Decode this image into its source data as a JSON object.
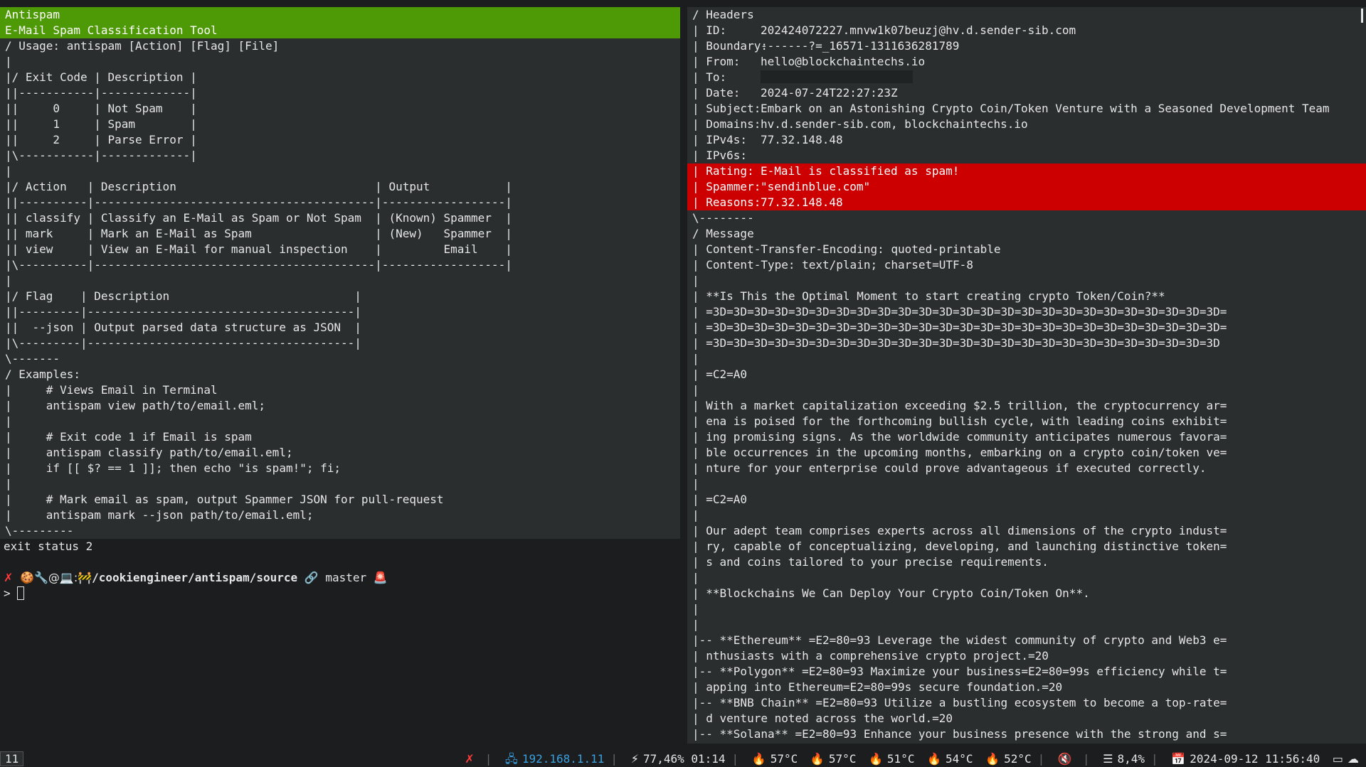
{
  "left": {
    "lines": [
      "Antispam",
      "E-Mail Spam Classification Tool",
      "/ Usage: antispam [Action] [Flag] [File]",
      "|",
      "|/ Exit Code | Description |",
      "||-----------|-------------|",
      "||     0     | Not Spam    |",
      "||     1     | Spam        |",
      "||     2     | Parse Error |",
      "|\\-----------|-------------|",
      "|",
      "|/ Action   | Description                             | Output           |",
      "||----------|-----------------------------------------|------------------|",
      "|| classify | Classify an E-Mail as Spam or Not Spam  | (Known) Spammer  |",
      "|| mark     | Mark an E-Mail as Spam                  | (New)   Spammer  |",
      "|| view     | View an E-Mail for manual inspection    |         Email    |",
      "|\\----------|-----------------------------------------|------------------|",
      "|",
      "|/ Flag    | Description                           |",
      "||---------|---------------------------------------|",
      "||  --json | Output parsed data structure as JSON  |",
      "|\\---------|---------------------------------------|",
      "\\-------",
      "/ Examples:",
      "|     # Views Email in Terminal",
      "|     antispam view path/to/email.eml;",
      "|",
      "|     # Exit code 1 if Email is spam",
      "|     antispam classify path/to/email.eml;",
      "|     if [[ $? == 1 ]]; then echo \"is spam!\"; fi;",
      "|",
      "|     # Mark email as spam, output Spammer JSON for pull-request",
      "|     antispam mark --json path/to/email.eml;",
      "\\---------"
    ]
  },
  "shell": {
    "exit_status": "exit status 2",
    "prompt_icons": "🍪🔧@💻:🚧",
    "path": "/cookiengineer/antispam/source",
    "branch_icon": "🔗",
    "branch": "master",
    "alarm_icon": "🚨",
    "input_prompt": "> ",
    "fail_icon": "✗"
  },
  "right": {
    "headers_title": "/ Headers",
    "id_label": "| ID:",
    "id": "202424072227.mnvw1k07beuzj@hv.d.sender-sib.com",
    "boundary_label": "| Boundary:",
    "boundary": "-------?=_16571-1311636281789",
    "from_label": "| From:",
    "from": "hello@blockchaintechs.io",
    "to_label": "| To:",
    "date_label": "| Date:",
    "date": "2024-07-24T22:27:23Z",
    "subject_label": "| Subject:",
    "subject": "Embark on an Astonishing Crypto Coin/Token Venture with a Seasoned Development Team",
    "domains_label": "| Domains:",
    "domains": "hv.d.sender-sib.com, blockchaintechs.io",
    "ipv4s_label": "| IPv4s:",
    "ipv4s": "77.32.148.48",
    "ipv6s_label": "| IPv6s:",
    "rating_label": "| Rating:",
    "rating": "E-Mail is classified as spam!",
    "spammer_label": "| Spammer:",
    "spammer": "\"sendinblue.com\"",
    "reasons_label": "| Reasons:",
    "reasons": "77.32.148.48",
    "headers_end": "\\--------",
    "message_lines": [
      "/ Message",
      "| Content-Transfer-Encoding: quoted-printable",
      "| Content-Type: text/plain; charset=UTF-8",
      "|",
      "| **Is This the Optimal Moment to start creating crypto Token/Coin?**",
      "| =3D=3D=3D=3D=3D=3D=3D=3D=3D=3D=3D=3D=3D=3D=3D=3D=3D=3D=3D=3D=3D=3D=3D=3D=3D=",
      "| =3D=3D=3D=3D=3D=3D=3D=3D=3D=3D=3D=3D=3D=3D=3D=3D=3D=3D=3D=3D=3D=3D=3D=3D=3D=",
      "| =3D=3D=3D=3D=3D=3D=3D=3D=3D=3D=3D=3D=3D=3D=3D=3D=3D=3D=3D=3D=3D=3D=3D=3D=3D",
      "|",
      "| =C2=A0",
      "|",
      "| With a market capitalization exceeding $2.5 trillion, the cryptocurrency ar=",
      "| ena is poised for the forthcoming bullish cycle, with leading coins exhibit=",
      "| ing promising signs. As the worldwide community anticipates numerous favora=",
      "| ble occurrences in the upcoming months, embarking on a crypto coin/token ve=",
      "| nture for your enterprise could prove advantageous if executed correctly.",
      "|",
      "| =C2=A0",
      "|",
      "| Our adept team comprises experts across all dimensions of the crypto indust=",
      "| ry, capable of conceptualizing, developing, and launching distinctive token=",
      "| s and coins tailored to your precise requirements.",
      "|",
      "| **Blockchains We Can Deploy Your Crypto Coin/Token On**.",
      "|",
      "|",
      "|-- **Ethereum** =E2=80=93 Leverage the widest community of crypto and Web3 e=",
      "| nthusiasts with a comprehensive crypto project.=20",
      "|-- **Polygon** =E2=80=93 Maximize your business=E2=80=99s efficiency while t=",
      "| apping into Ethereum=E2=80=99s secure foundation.=20",
      "|-- **BNB Chain** =E2=80=93 Utilize a bustling ecosystem to become a top-rate=",
      "| d venture noted across the world.=20",
      "|-- **Solana** =E2=80=93 Enhance your business presence with the strong and s="
    ]
  },
  "status": {
    "workspace": "11",
    "vpn_icon": "✗",
    "network_icon": "🖧",
    "ip": "192.168.1.11",
    "battery_icon": "⚡",
    "battery": "77,46% 01:14",
    "temp_icon": "🔥",
    "temps": [
      "57°C",
      "57°C",
      "51°C",
      "54°C",
      "52°C"
    ],
    "volume_icon": "🔇",
    "memory_icon": "☰",
    "memory": "8,4%",
    "calendar_icon": "📅",
    "datetime": "2024-09-12 11:56:40",
    "tray_icon_1": "▭",
    "tray_icon_2": "☁"
  }
}
